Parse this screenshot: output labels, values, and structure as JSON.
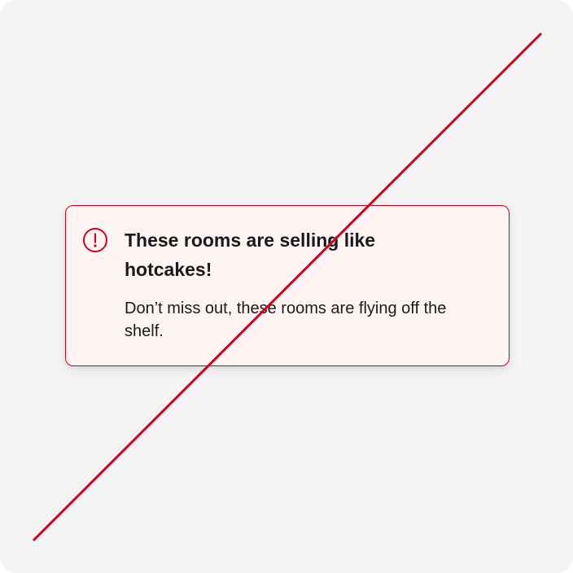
{
  "alert": {
    "icon": "exclamation-circle-icon",
    "title": "These rooms are selling like hotcakes!",
    "body": "Don’t miss out, these rooms are flying off the shelf."
  },
  "colors": {
    "page_background": "#f4f4f4",
    "alert_background": "#fff4f4",
    "accent_red": "#d0021b",
    "text": "#1a1a1a"
  }
}
